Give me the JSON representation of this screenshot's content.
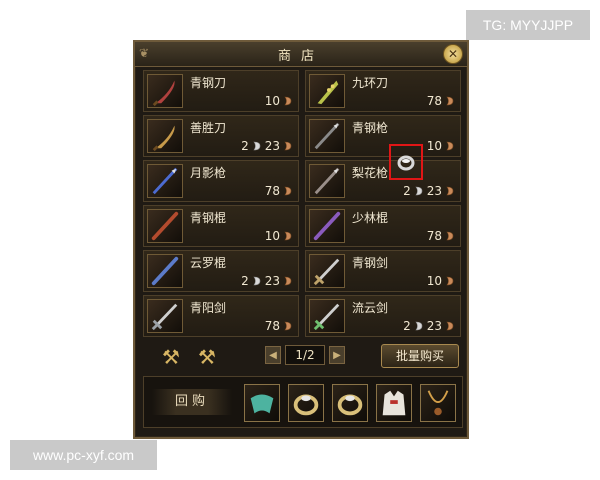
{
  "watermarks": {
    "top_right": "TG: MYYJJPP",
    "bottom_left": "www.pc-xyf.com"
  },
  "shop": {
    "title": "商店",
    "close_icon": "close-icon",
    "items": [
      {
        "name": "青钢刀",
        "price": "10",
        "currency": "copper",
        "icon": "blade-icon",
        "accent": "#b0413e"
      },
      {
        "name": "九环刀",
        "price": "78",
        "currency": "copper",
        "icon": "ring-blade-icon",
        "accent": "#b9c24a"
      },
      {
        "name": "善胜刀",
        "silver": "2",
        "price": "23",
        "currency": "mixed",
        "icon": "blade-icon",
        "accent": "#c79a4a"
      },
      {
        "name": "青钢枪",
        "price": "10",
        "currency": "copper",
        "icon": "spear-icon",
        "accent": "#8a8a8a"
      },
      {
        "name": "月影枪",
        "price": "78",
        "currency": "copper",
        "icon": "spear-icon",
        "accent": "#4c6bd1"
      },
      {
        "name": "梨花枪",
        "silver": "2",
        "price": "23",
        "currency": "mixed",
        "icon": "spear-icon",
        "accent": "#9a8f8a"
      },
      {
        "name": "青钢棍",
        "price": "10",
        "currency": "copper",
        "icon": "staff-icon",
        "accent": "#b34b2e"
      },
      {
        "name": "少林棍",
        "price": "78",
        "currency": "copper",
        "icon": "staff-icon",
        "accent": "#8a5bbd"
      },
      {
        "name": "云罗棍",
        "silver": "2",
        "price": "23",
        "currency": "mixed",
        "icon": "staff-icon",
        "accent": "#5c7bc9"
      },
      {
        "name": "青钢剑",
        "price": "10",
        "currency": "copper",
        "icon": "sword-icon",
        "accent": "#bfa36a"
      },
      {
        "name": "青阳剑",
        "price": "78",
        "currency": "copper",
        "icon": "sword-icon",
        "accent": "#9aa0a6"
      },
      {
        "name": "流云剑",
        "silver": "2",
        "price": "23",
        "currency": "mixed",
        "icon": "sword-icon",
        "accent": "#6fbf6f"
      }
    ],
    "pager": {
      "current": "1/2"
    },
    "bulk_buy_label": "批量购买",
    "buyback_label": "回购",
    "buyback_items": [
      "ribbon-icon",
      "ring-icon",
      "ring-icon",
      "robe-icon",
      "necklace-icon"
    ],
    "colors": {
      "highlight": "#e01616",
      "gold": "#d8b664"
    }
  }
}
